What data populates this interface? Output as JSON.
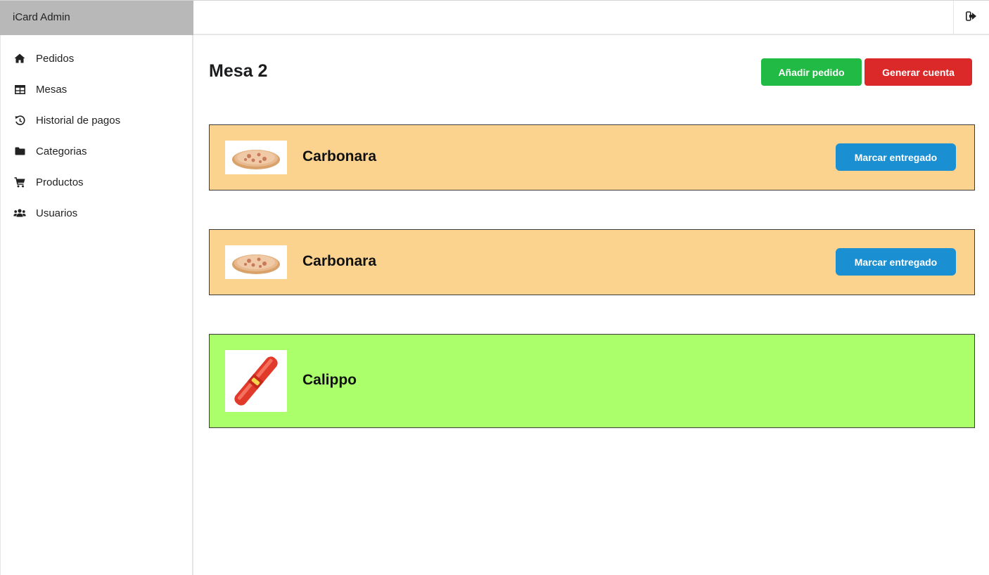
{
  "app": {
    "brand": "iCard Admin"
  },
  "topbar": {
    "logout_icon": "sign-out-icon"
  },
  "sidebar": {
    "items": [
      {
        "label": "Pedidos",
        "icon": "home-icon"
      },
      {
        "label": "Mesas",
        "icon": "table-icon"
      },
      {
        "label": "Historial de pagos",
        "icon": "history-icon"
      },
      {
        "label": "Categorias",
        "icon": "folder-icon"
      },
      {
        "label": "Productos",
        "icon": "cart-icon"
      },
      {
        "label": "Usuarios",
        "icon": "users-icon"
      }
    ]
  },
  "main": {
    "title": "Mesa 2",
    "add_order_label": "Añadir pedido",
    "generate_bill_label": "Generar cuenta",
    "orders": [
      {
        "name": "Carbonara",
        "status": "pending",
        "image": "pizza",
        "action_label": "Marcar entregado"
      },
      {
        "name": "Carbonara",
        "status": "pending",
        "image": "pizza",
        "action_label": "Marcar entregado"
      },
      {
        "name": "Calippo",
        "status": "delivered",
        "image": "calippo"
      }
    ]
  },
  "colors": {
    "pending": "#fbd38f",
    "delivered": "#abff6a",
    "add_button": "#21ba45",
    "bill_button": "#db2828",
    "deliver_button": "#1a8fd1"
  }
}
